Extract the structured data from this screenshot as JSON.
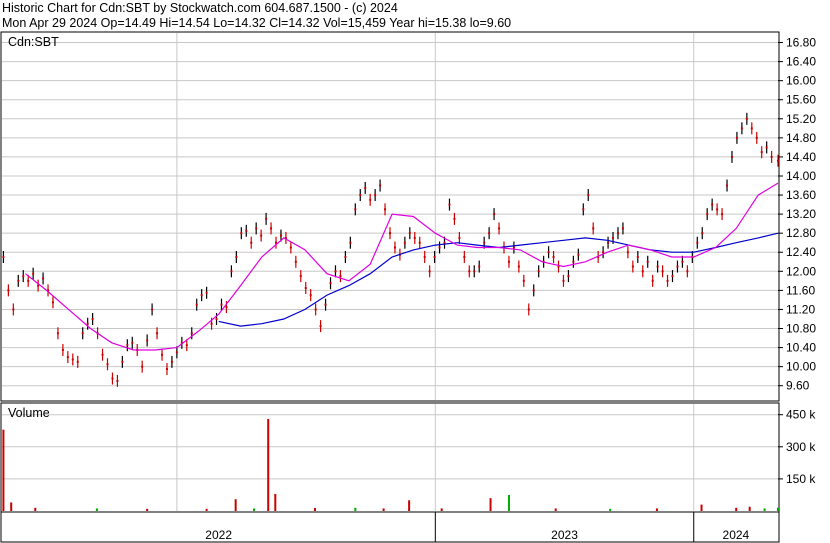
{
  "header": {
    "line1": "Historic Chart for Cdn:SBT by Stockwatch.com 604.687.1500 - (c) 2024",
    "line2": "Mon Apr 29 2024  Op=14.49  Hi=14.54  Lo=14.32  Cl=14.32  Vol=15,459  Year hi=15.38  lo=9.60"
  },
  "colors": {
    "price_up": "#000000",
    "price_down": "#cc0000",
    "ma_short": "#e000e0",
    "ma_long": "#0000cc",
    "volume_up": "#cc0000",
    "volume_down": "#00aa00",
    "grid": "#c8c8c8"
  },
  "chart_data": [
    {
      "type": "line",
      "title": "Cdn:SBT",
      "ylim": [
        9.3,
        17.0
      ],
      "yticks": [
        "16.80",
        "16.40",
        "16.00",
        "15.60",
        "15.20",
        "14.80",
        "14.40",
        "14.00",
        "13.60",
        "13.20",
        "12.80",
        "12.40",
        "12.00",
        "11.60",
        "11.20",
        "10.80",
        "10.40",
        "10.00",
        "9.60"
      ],
      "xlim": [
        "2021-04-29",
        "2024-04-29"
      ],
      "price_points": [
        [
          "2021-05-01",
          12.3
        ],
        [
          "2021-05-08",
          11.6
        ],
        [
          "2021-05-15",
          11.2
        ],
        [
          "2021-05-22",
          11.8
        ],
        [
          "2021-05-29",
          11.9
        ],
        [
          "2021-06-05",
          11.8
        ],
        [
          "2021-06-12",
          11.95
        ],
        [
          "2021-06-19",
          11.7
        ],
        [
          "2021-06-26",
          11.85
        ],
        [
          "2021-07-03",
          11.6
        ],
        [
          "2021-07-10",
          11.35
        ],
        [
          "2021-07-17",
          10.7
        ],
        [
          "2021-07-24",
          10.35
        ],
        [
          "2021-07-31",
          10.2
        ],
        [
          "2021-08-07",
          10.15
        ],
        [
          "2021-08-14",
          10.1
        ],
        [
          "2021-08-21",
          10.7
        ],
        [
          "2021-08-28",
          10.9
        ],
        [
          "2021-09-04",
          11.0
        ],
        [
          "2021-09-11",
          10.7
        ],
        [
          "2021-09-18",
          10.25
        ],
        [
          "2021-09-25",
          10.05
        ],
        [
          "2021-10-02",
          9.75
        ],
        [
          "2021-10-09",
          9.7
        ],
        [
          "2021-10-16",
          10.1
        ],
        [
          "2021-10-23",
          10.45
        ],
        [
          "2021-10-30",
          10.5
        ],
        [
          "2021-11-06",
          10.35
        ],
        [
          "2021-11-13",
          10.0
        ],
        [
          "2021-11-20",
          10.55
        ],
        [
          "2021-11-27",
          11.2
        ],
        [
          "2021-12-04",
          10.7
        ],
        [
          "2021-12-11",
          10.25
        ],
        [
          "2021-12-18",
          9.95
        ],
        [
          "2021-12-25",
          10.1
        ],
        [
          "2022-01-01",
          10.3
        ],
        [
          "2022-01-08",
          10.5
        ],
        [
          "2022-01-15",
          10.45
        ],
        [
          "2022-01-22",
          10.7
        ],
        [
          "2022-01-29",
          11.3
        ],
        [
          "2022-02-05",
          11.5
        ],
        [
          "2022-02-12",
          11.55
        ],
        [
          "2022-02-19",
          10.9
        ],
        [
          "2022-02-26",
          11.0
        ],
        [
          "2022-03-05",
          11.3
        ],
        [
          "2022-03-12",
          11.25
        ],
        [
          "2022-03-19",
          12.0
        ],
        [
          "2022-03-26",
          12.3
        ],
        [
          "2022-04-02",
          12.8
        ],
        [
          "2022-04-09",
          12.85
        ],
        [
          "2022-04-16",
          12.6
        ],
        [
          "2022-04-23",
          12.9
        ],
        [
          "2022-04-30",
          12.75
        ],
        [
          "2022-05-07",
          13.1
        ],
        [
          "2022-05-14",
          12.9
        ],
        [
          "2022-05-21",
          12.6
        ],
        [
          "2022-05-28",
          12.75
        ],
        [
          "2022-06-04",
          12.7
        ],
        [
          "2022-06-11",
          12.5
        ],
        [
          "2022-06-18",
          12.2
        ],
        [
          "2022-06-25",
          11.9
        ],
        [
          "2022-07-02",
          11.65
        ],
        [
          "2022-07-09",
          11.5
        ],
        [
          "2022-07-16",
          11.2
        ],
        [
          "2022-07-23",
          10.85
        ],
        [
          "2022-07-30",
          11.3
        ],
        [
          "2022-08-06",
          11.75
        ],
        [
          "2022-08-13",
          12.0
        ],
        [
          "2022-08-20",
          11.9
        ],
        [
          "2022-08-27",
          12.3
        ],
        [
          "2022-09-03",
          12.6
        ],
        [
          "2022-09-10",
          13.3
        ],
        [
          "2022-09-17",
          13.6
        ],
        [
          "2022-09-24",
          13.75
        ],
        [
          "2022-10-01",
          13.5
        ],
        [
          "2022-10-08",
          13.6
        ],
        [
          "2022-10-15",
          13.8
        ],
        [
          "2022-10-22",
          13.3
        ],
        [
          "2022-10-29",
          12.8
        ],
        [
          "2022-11-05",
          12.5
        ],
        [
          "2022-11-12",
          12.35
        ],
        [
          "2022-11-19",
          12.6
        ],
        [
          "2022-11-26",
          12.8
        ],
        [
          "2022-12-03",
          12.7
        ],
        [
          "2022-12-10",
          12.6
        ],
        [
          "2022-12-17",
          12.3
        ],
        [
          "2022-12-24",
          12.0
        ],
        [
          "2022-12-31",
          12.3
        ],
        [
          "2023-01-07",
          12.5
        ],
        [
          "2023-01-14",
          12.6
        ],
        [
          "2023-01-21",
          13.4
        ],
        [
          "2023-01-28",
          13.1
        ],
        [
          "2023-02-04",
          12.7
        ],
        [
          "2023-02-11",
          12.3
        ],
        [
          "2023-02-18",
          12.0
        ],
        [
          "2023-02-25",
          12.0
        ],
        [
          "2023-03-04",
          12.1
        ],
        [
          "2023-03-11",
          12.6
        ],
        [
          "2023-03-18",
          12.8
        ],
        [
          "2023-03-25",
          13.2
        ],
        [
          "2023-04-01",
          12.9
        ],
        [
          "2023-04-08",
          12.5
        ],
        [
          "2023-04-15",
          12.2
        ],
        [
          "2023-04-22",
          12.5
        ],
        [
          "2023-04-29",
          12.1
        ],
        [
          "2023-05-06",
          11.8
        ],
        [
          "2023-05-13",
          11.2
        ],
        [
          "2023-05-20",
          11.6
        ],
        [
          "2023-05-27",
          12.0
        ],
        [
          "2023-06-03",
          12.2
        ],
        [
          "2023-06-10",
          12.4
        ],
        [
          "2023-06-17",
          12.3
        ],
        [
          "2023-06-24",
          12.1
        ],
        [
          "2023-07-01",
          11.8
        ],
        [
          "2023-07-08",
          11.9
        ],
        [
          "2023-07-15",
          12.2
        ],
        [
          "2023-07-22",
          12.35
        ],
        [
          "2023-07-29",
          13.3
        ],
        [
          "2023-08-05",
          13.6
        ],
        [
          "2023-08-12",
          12.9
        ],
        [
          "2023-08-19",
          12.3
        ],
        [
          "2023-08-26",
          12.4
        ],
        [
          "2023-09-02",
          12.6
        ],
        [
          "2023-09-09",
          12.7
        ],
        [
          "2023-09-16",
          12.8
        ],
        [
          "2023-09-23",
          12.9
        ],
        [
          "2023-09-30",
          12.4
        ],
        [
          "2023-10-07",
          12.1
        ],
        [
          "2023-10-14",
          12.3
        ],
        [
          "2023-10-21",
          12.0
        ],
        [
          "2023-10-28",
          12.2
        ],
        [
          "2023-11-04",
          11.8
        ],
        [
          "2023-11-11",
          12.1
        ],
        [
          "2023-11-18",
          12.0
        ],
        [
          "2023-11-25",
          11.8
        ],
        [
          "2023-12-02",
          11.9
        ],
        [
          "2023-12-09",
          12.1
        ],
        [
          "2023-12-16",
          12.2
        ],
        [
          "2023-12-23",
          12.0
        ],
        [
          "2023-12-30",
          12.3
        ],
        [
          "2024-01-06",
          12.6
        ],
        [
          "2024-01-13",
          12.8
        ],
        [
          "2024-01-20",
          13.2
        ],
        [
          "2024-01-27",
          13.4
        ],
        [
          "2024-02-03",
          13.3
        ],
        [
          "2024-02-10",
          13.2
        ],
        [
          "2024-02-17",
          13.8
        ],
        [
          "2024-02-24",
          14.4
        ],
        [
          "2024-03-02",
          14.8
        ],
        [
          "2024-03-09",
          15.0
        ],
        [
          "2024-03-16",
          15.2
        ],
        [
          "2024-03-23",
          15.0
        ],
        [
          "2024-03-30",
          14.8
        ],
        [
          "2024-04-06",
          14.5
        ],
        [
          "2024-04-13",
          14.6
        ],
        [
          "2024-04-20",
          14.4
        ],
        [
          "2024-04-29",
          14.32
        ]
      ],
      "ma_short": [
        [
          "2021-06-01",
          11.95
        ],
        [
          "2021-07-01",
          11.6
        ],
        [
          "2021-08-01",
          11.2
        ],
        [
          "2021-09-01",
          10.8
        ],
        [
          "2021-10-01",
          10.5
        ],
        [
          "2021-11-01",
          10.35
        ],
        [
          "2021-12-01",
          10.35
        ],
        [
          "2022-01-01",
          10.4
        ],
        [
          "2022-02-01",
          10.75
        ],
        [
          "2022-03-01",
          11.1
        ],
        [
          "2022-04-01",
          11.7
        ],
        [
          "2022-05-01",
          12.3
        ],
        [
          "2022-06-01",
          12.7
        ],
        [
          "2022-07-01",
          12.45
        ],
        [
          "2022-08-01",
          11.95
        ],
        [
          "2022-09-01",
          11.8
        ],
        [
          "2022-10-01",
          12.15
        ],
        [
          "2022-11-01",
          13.2
        ],
        [
          "2022-12-01",
          13.15
        ],
        [
          "2023-01-01",
          12.8
        ],
        [
          "2023-02-01",
          12.55
        ],
        [
          "2023-03-01",
          12.5
        ],
        [
          "2023-04-01",
          12.5
        ],
        [
          "2023-05-01",
          12.45
        ],
        [
          "2023-06-01",
          12.2
        ],
        [
          "2023-07-01",
          12.1
        ],
        [
          "2023-08-01",
          12.2
        ],
        [
          "2023-09-01",
          12.4
        ],
        [
          "2023-10-01",
          12.55
        ],
        [
          "2023-11-01",
          12.45
        ],
        [
          "2023-12-01",
          12.3
        ],
        [
          "2024-01-01",
          12.3
        ],
        [
          "2024-02-01",
          12.5
        ],
        [
          "2024-03-01",
          12.9
        ],
        [
          "2024-04-01",
          13.6
        ],
        [
          "2024-04-29",
          13.85
        ]
      ],
      "ma_long": [
        [
          "2022-03-01",
          10.95
        ],
        [
          "2022-04-01",
          10.85
        ],
        [
          "2022-05-01",
          10.9
        ],
        [
          "2022-06-01",
          11.0
        ],
        [
          "2022-07-01",
          11.2
        ],
        [
          "2022-08-01",
          11.5
        ],
        [
          "2022-09-01",
          11.7
        ],
        [
          "2022-10-01",
          11.95
        ],
        [
          "2022-11-01",
          12.3
        ],
        [
          "2022-12-01",
          12.45
        ],
        [
          "2023-01-01",
          12.55
        ],
        [
          "2023-02-01",
          12.6
        ],
        [
          "2023-03-01",
          12.55
        ],
        [
          "2023-04-01",
          12.5
        ],
        [
          "2023-05-01",
          12.55
        ],
        [
          "2023-06-01",
          12.6
        ],
        [
          "2023-07-01",
          12.65
        ],
        [
          "2023-08-01",
          12.7
        ],
        [
          "2023-09-01",
          12.65
        ],
        [
          "2023-10-01",
          12.55
        ],
        [
          "2023-11-01",
          12.45
        ],
        [
          "2023-12-01",
          12.4
        ],
        [
          "2024-01-01",
          12.4
        ],
        [
          "2024-02-01",
          12.5
        ],
        [
          "2024-03-01",
          12.6
        ],
        [
          "2024-04-01",
          12.7
        ],
        [
          "2024-04-29",
          12.8
        ]
      ]
    },
    {
      "type": "bar",
      "title": "Volume",
      "ylim": [
        0,
        500000
      ],
      "yticks": [
        "450 k",
        "300 k",
        "150 k"
      ],
      "bars": [
        [
          "2021-05-01",
          380000,
          "up"
        ],
        [
          "2021-05-12",
          40000,
          "up"
        ],
        [
          "2021-06-15",
          15000,
          "up"
        ],
        [
          "2021-09-10",
          12000,
          "down"
        ],
        [
          "2021-11-20",
          10000,
          "up"
        ],
        [
          "2022-02-12",
          10000,
          "up"
        ],
        [
          "2022-03-25",
          55000,
          "up"
        ],
        [
          "2022-04-20",
          12000,
          "down"
        ],
        [
          "2022-05-10",
          430000,
          "up"
        ],
        [
          "2022-05-20",
          80000,
          "up"
        ],
        [
          "2022-07-15",
          14000,
          "up"
        ],
        [
          "2022-09-10",
          15000,
          "down"
        ],
        [
          "2022-10-20",
          12000,
          "up"
        ],
        [
          "2022-11-25",
          50000,
          "up"
        ],
        [
          "2023-01-10",
          12000,
          "up"
        ],
        [
          "2023-03-20",
          60000,
          "up"
        ],
        [
          "2023-04-15",
          75000,
          "down"
        ],
        [
          "2023-06-20",
          12000,
          "up"
        ],
        [
          "2023-09-05",
          10000,
          "down"
        ],
        [
          "2023-11-10",
          12000,
          "up"
        ],
        [
          "2024-01-12",
          30000,
          "up"
        ],
        [
          "2024-03-01",
          15000,
          "up"
        ],
        [
          "2024-03-20",
          20000,
          "up"
        ],
        [
          "2024-04-10",
          12000,
          "down"
        ],
        [
          "2024-04-29",
          15459,
          "down"
        ]
      ]
    }
  ],
  "x_axis": {
    "labels": [
      "2022",
      "2023",
      "2024"
    ]
  }
}
